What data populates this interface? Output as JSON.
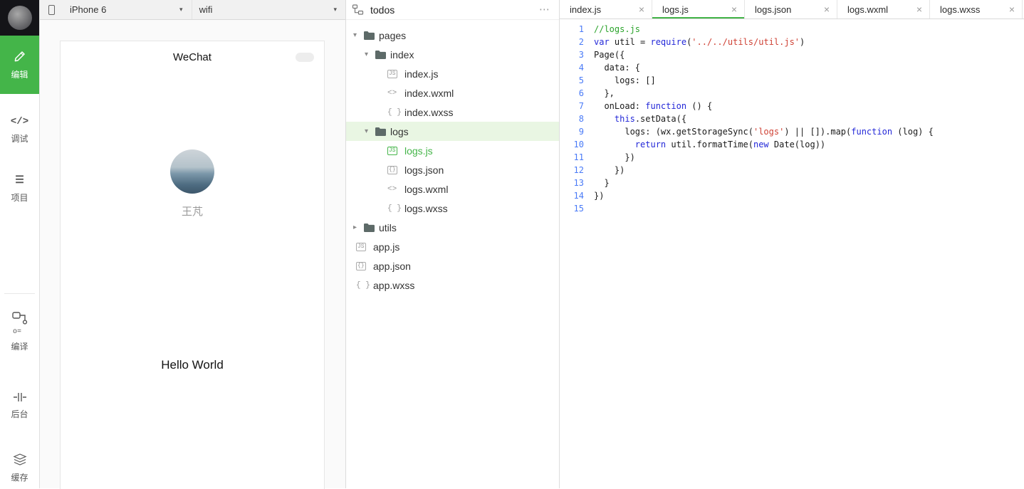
{
  "colors": {
    "accent_green": "#44b549",
    "line_number_blue": "#4a7bf7",
    "comment_green": "#2aa32a",
    "keyword_blue": "#2328d8",
    "string_red": "#cf4134"
  },
  "activity_bar": {
    "items": [
      {
        "id": "edit",
        "label": "编辑",
        "icon": "pencil-icon",
        "active": true
      },
      {
        "id": "debug",
        "label": "调试",
        "icon": "code-icon",
        "active": false
      },
      {
        "id": "project",
        "label": "项目",
        "icon": "list-icon",
        "active": false
      }
    ],
    "tools": [
      {
        "id": "compile",
        "label": "编译",
        "icon": "compile-icon"
      },
      {
        "id": "backend",
        "label": "后台",
        "icon": "backend-icon"
      },
      {
        "id": "cache",
        "label": "缓存",
        "icon": "layers-icon"
      }
    ]
  },
  "simulator": {
    "device_label": "iPhone 6",
    "network_label": "wifi",
    "phone": {
      "title": "WeChat",
      "username": "王芃",
      "message": "Hello World"
    }
  },
  "explorer": {
    "title": "todos",
    "items": [
      {
        "type": "folder",
        "label": "pages",
        "depth": 0,
        "expanded": true
      },
      {
        "type": "folder",
        "label": "index",
        "depth": 1,
        "expanded": true
      },
      {
        "type": "file",
        "label": "index.js",
        "depth": 2,
        "icon": "js"
      },
      {
        "type": "file",
        "label": "index.wxml",
        "depth": 2,
        "icon": "wxml"
      },
      {
        "type": "file",
        "label": "index.wxss",
        "depth": 2,
        "icon": "wxss"
      },
      {
        "type": "folder",
        "label": "logs",
        "depth": 1,
        "expanded": true,
        "highlighted": true
      },
      {
        "type": "file",
        "label": "logs.js",
        "depth": 2,
        "icon": "js",
        "selected": true
      },
      {
        "type": "file",
        "label": "logs.json",
        "depth": 2,
        "icon": "json"
      },
      {
        "type": "file",
        "label": "logs.wxml",
        "depth": 2,
        "icon": "wxml"
      },
      {
        "type": "file",
        "label": "logs.wxss",
        "depth": 2,
        "icon": "wxss"
      },
      {
        "type": "folder",
        "label": "utils",
        "depth": 0,
        "expanded": false
      },
      {
        "type": "file",
        "label": "app.js",
        "depth": 0,
        "icon": "js"
      },
      {
        "type": "file",
        "label": "app.json",
        "depth": 0,
        "icon": "json"
      },
      {
        "type": "file",
        "label": "app.wxss",
        "depth": 0,
        "icon": "wxss"
      }
    ]
  },
  "editor": {
    "tabs": [
      {
        "label": "index.js",
        "active": false
      },
      {
        "label": "logs.js",
        "active": true
      },
      {
        "label": "logs.json",
        "active": false
      },
      {
        "label": "logs.wxml",
        "active": false
      },
      {
        "label": "logs.wxss",
        "active": false
      }
    ],
    "code": {
      "lines": [
        [
          [
            "c",
            "//logs.js"
          ]
        ],
        [
          [
            "k",
            "var"
          ],
          [
            "p",
            " util = "
          ],
          [
            "k",
            "require"
          ],
          [
            "p",
            "("
          ],
          [
            "s",
            "'../../utils/util.js'"
          ],
          [
            "p",
            ")"
          ]
        ],
        [
          [
            "p",
            "Page({"
          ]
        ],
        [
          [
            "p",
            "  data: {"
          ]
        ],
        [
          [
            "p",
            "    logs: []"
          ]
        ],
        [
          [
            "p",
            "  },"
          ]
        ],
        [
          [
            "p",
            "  onLoad: "
          ],
          [
            "k",
            "function"
          ],
          [
            "p",
            " () {"
          ]
        ],
        [
          [
            "p",
            "    "
          ],
          [
            "k",
            "this"
          ],
          [
            "p",
            ".setData({"
          ]
        ],
        [
          [
            "p",
            "      logs: (wx.getStorageSync("
          ],
          [
            "s",
            "'logs'"
          ],
          [
            "p",
            ") || []).map("
          ],
          [
            "k",
            "function"
          ],
          [
            "p",
            " (log) {"
          ]
        ],
        [
          [
            "p",
            "        "
          ],
          [
            "k",
            "return"
          ],
          [
            "p",
            " util.formatTime("
          ],
          [
            "k",
            "new"
          ],
          [
            "p",
            " Date(log))"
          ]
        ],
        [
          [
            "p",
            "      })"
          ]
        ],
        [
          [
            "p",
            "    })"
          ]
        ],
        [
          [
            "p",
            "  }"
          ]
        ],
        [
          [
            "p",
            "})"
          ]
        ],
        []
      ]
    }
  }
}
